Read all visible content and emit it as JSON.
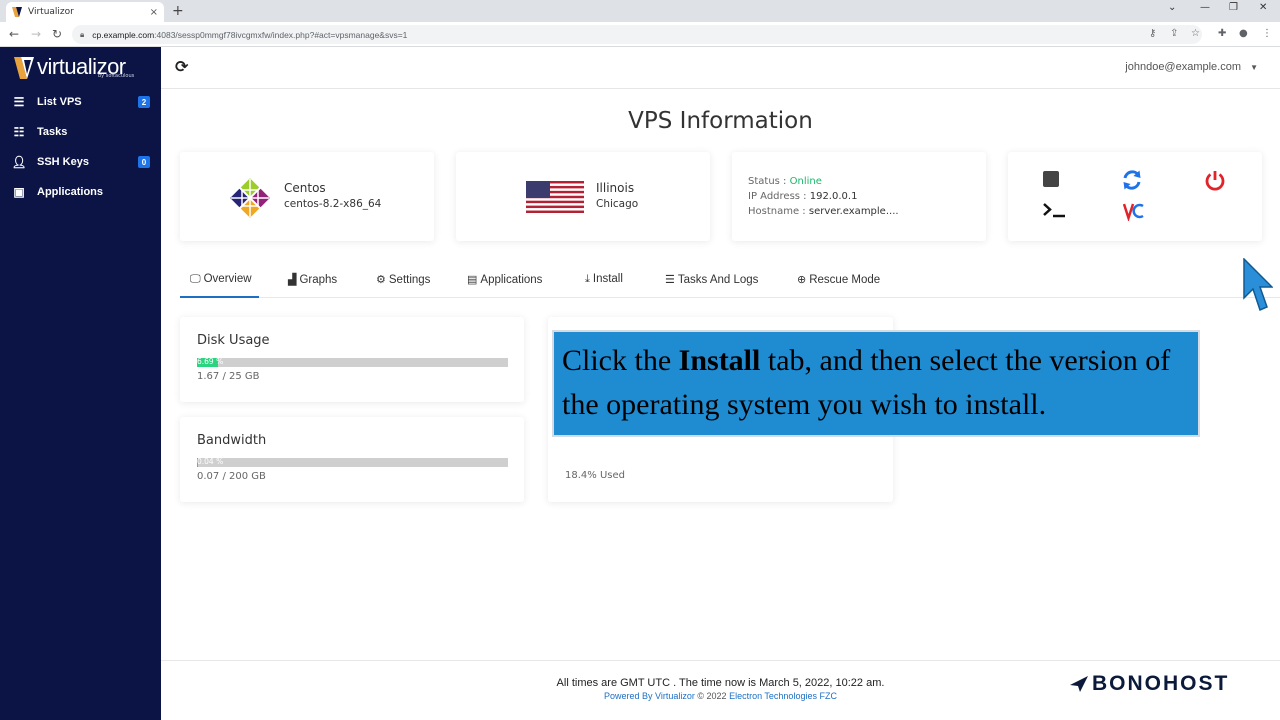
{
  "browser": {
    "tab_title": "Virtualizor",
    "tab_close": "×",
    "new_tab": "+",
    "url_host": "cp.example.com",
    "url_rest": ":4083/sessp0mmgf78ivcgmxfw/index.php?#act=vpsmanage&svs=1"
  },
  "sidebar": {
    "logo_text": "virtualizor",
    "logo_sub": "by softaculous",
    "items": [
      {
        "label": "List VPS",
        "icon": "server-icon",
        "badge": "2"
      },
      {
        "label": "Tasks",
        "icon": "tasks-icon",
        "badge": ""
      },
      {
        "label": "SSH Keys",
        "icon": "user-key-icon",
        "badge": "0"
      },
      {
        "label": "Applications",
        "icon": "box-icon",
        "badge": ""
      }
    ]
  },
  "topbar": {
    "user": "johndoe@example.com"
  },
  "page": {
    "title": "VPS Information"
  },
  "os_card": {
    "name": "Centos",
    "version": "centos-8.2-x86_64"
  },
  "location_card": {
    "region": "Illinois",
    "city": "Chicago"
  },
  "status_card": {
    "status_label": "Status :",
    "status_value": "Online",
    "ip_label": "IP Address :",
    "ip_value": "192.0.0.1",
    "host_label": "Hostname :",
    "host_value": "server.example...."
  },
  "tabs": [
    {
      "label": "Overview",
      "icon": "monitor-icon"
    },
    {
      "label": "Graphs",
      "icon": "chart-icon"
    },
    {
      "label": "Settings",
      "icon": "gear-icon"
    },
    {
      "label": "Applications",
      "icon": "boxes-icon"
    },
    {
      "label": "Install",
      "icon": "download-icon"
    },
    {
      "label": "Tasks And Logs",
      "icon": "list-icon"
    },
    {
      "label": "Rescue Mode",
      "icon": "lifebuoy-icon"
    }
  ],
  "disk": {
    "title": "Disk Usage",
    "percent_label": "6.69 %",
    "percent": 6.69,
    "usage": "1.67 / 25 GB"
  },
  "bandwidth": {
    "title": "Bandwidth",
    "percent_label": "0.04 %",
    "percent": 0.04,
    "usage": "0.07 / 200 GB"
  },
  "ram": {
    "used": "18.4% Used"
  },
  "caption": {
    "part1": "Click the ",
    "bold": "Install",
    "part2": " tab, and then select the version of the operating system you wish to install."
  },
  "footer": {
    "line1": "All times are GMT UTC . The time now is March 5, 2022, 10:22 am.",
    "powered": "Powered By Virtualizor",
    "copy": " © 2022 ",
    "company": "Electron Technologies FZC"
  },
  "watermark": "BONOHOST",
  "colors": {
    "sidebar": "#0b1445",
    "accent": "#1d6fc4",
    "online": "#18b86b",
    "progress": "#2bd47f",
    "caption_bg": "#1f8bd1"
  }
}
